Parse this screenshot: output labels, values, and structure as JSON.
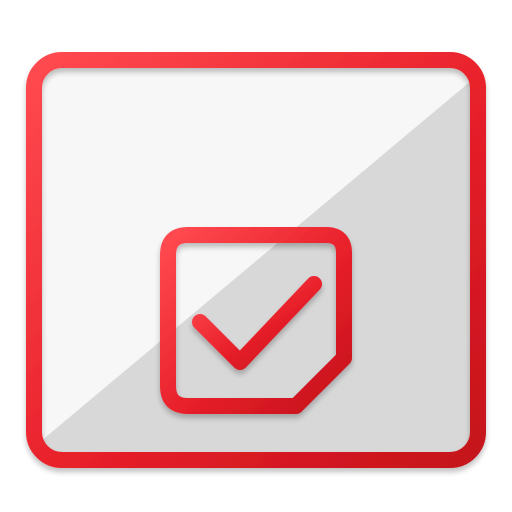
{
  "icon": {
    "name": "calendar-check-icon",
    "parts": [
      "calendar-frame",
      "calendar-rings",
      "calendar-header-divider",
      "check-box",
      "check-mark"
    ]
  },
  "colors": {
    "stroke_primary": "#e8202a",
    "stroke_dark": "#c4121b",
    "stroke_highlight": "#ff4a50",
    "panel_light": "#f7f7f7",
    "panel_shade": "#d8d8d8",
    "background": "#ffffff"
  }
}
